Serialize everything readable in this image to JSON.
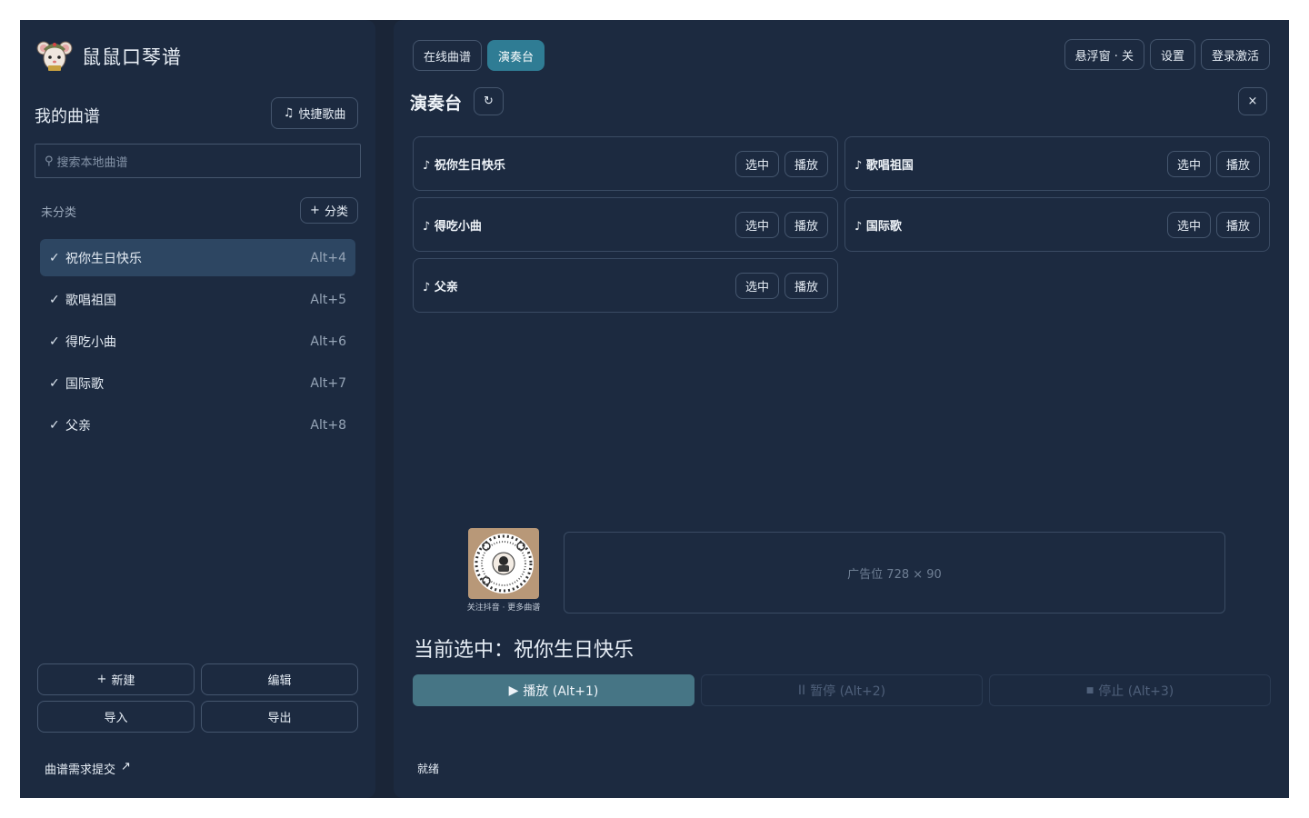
{
  "app": {
    "title": "鼠鼠口琴谱"
  },
  "sidebar": {
    "section_title": "我的曲谱",
    "quick_song_label": "快捷歌曲",
    "search_placeholder": "搜索本地曲谱",
    "category_label": "未分类",
    "add_category_label": "分类",
    "songs": [
      {
        "name": "祝你生日快乐",
        "hotkey": "Alt+4",
        "active": true
      },
      {
        "name": "歌唱祖国",
        "hotkey": "Alt+5",
        "active": false
      },
      {
        "name": "得吃小曲",
        "hotkey": "Alt+6",
        "active": false
      },
      {
        "name": "国际歌",
        "hotkey": "Alt+7",
        "active": false
      },
      {
        "name": "父亲",
        "hotkey": "Alt+8",
        "active": false
      }
    ],
    "buttons": {
      "new": "新建",
      "edit": "编辑",
      "import": "导入",
      "export": "导出"
    },
    "request_link": "曲谱需求提交"
  },
  "main": {
    "tabs": [
      {
        "label": "在线曲谱",
        "active": false
      },
      {
        "label": "演奏台",
        "active": true
      }
    ],
    "top_right": {
      "float_window": "悬浮窗 · 关",
      "settings": "设置",
      "login": "登录激活"
    },
    "stage_title": "演奏台",
    "cards": [
      {
        "title": "祝你生日快乐"
      },
      {
        "title": "歌唱祖国"
      },
      {
        "title": "得吃小曲"
      },
      {
        "title": "国际歌"
      },
      {
        "title": "父亲"
      }
    ],
    "select_label": "选中",
    "play_label": "播放",
    "qr_caption": "关注抖音 · 更多曲谱",
    "ad_text": "广告位 728 × 90",
    "current_label": "当前选中：",
    "current_song": "祝你生日快乐",
    "controls": {
      "play": "播放 (Alt+1)",
      "pause": "暂停 (Alt+2)",
      "stop": "停止 (Alt+3)"
    },
    "status": "就绪"
  },
  "colors": {
    "background": "#1a2537",
    "panel": "#1c2a40",
    "accent": "#2f7c94",
    "active_item": "#2d4662",
    "play_button": "#467585"
  }
}
